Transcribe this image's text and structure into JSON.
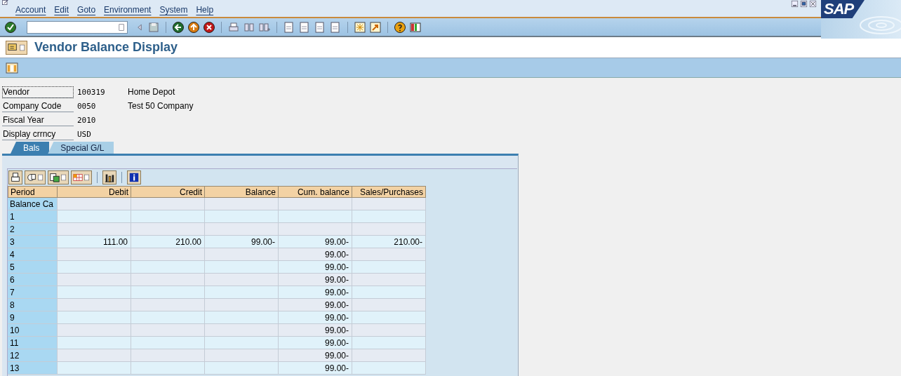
{
  "menu": [
    {
      "label": "Account"
    },
    {
      "label": "Edit"
    },
    {
      "label": "Goto"
    },
    {
      "label": "Environment"
    },
    {
      "label": "System"
    },
    {
      "label": "Help"
    }
  ],
  "logo": "SAP",
  "title": "Vendor Balance Display",
  "header_fields": [
    {
      "label": "Vendor",
      "value": "100319",
      "description": "Home Depot",
      "focused": true
    },
    {
      "label": "Company Code",
      "value": "0050",
      "description": "Test 50 Company",
      "focused": false
    },
    {
      "label": "Fiscal Year",
      "value": "2010",
      "focused": false
    },
    {
      "label": "Display crrncy",
      "value": "USD",
      "focused": false
    }
  ],
  "tabs": [
    {
      "label": "Bals",
      "selected": true
    },
    {
      "label": "Special G/L",
      "selected": false
    }
  ],
  "table": {
    "columns": [
      "Period",
      "Debit",
      "Credit",
      "Balance",
      "Cum. balance",
      "Sales/Purchases"
    ],
    "rows": [
      {
        "period": "Balance Ca"
      },
      {
        "period": "1"
      },
      {
        "period": "2"
      },
      {
        "period": "3",
        "debit": "111.00",
        "credit": "210.00",
        "balance": "99.00-",
        "cum_balance": "99.00-",
        "sales": "210.00-"
      },
      {
        "period": "4",
        "cum_balance": "99.00-"
      },
      {
        "period": "5",
        "cum_balance": "99.00-"
      },
      {
        "period": "6",
        "cum_balance": "99.00-"
      },
      {
        "period": "7",
        "cum_balance": "99.00-"
      },
      {
        "period": "8",
        "cum_balance": "99.00-"
      },
      {
        "period": "9",
        "cum_balance": "99.00-"
      },
      {
        "period": "10",
        "cum_balance": "99.00-"
      },
      {
        "period": "11",
        "cum_balance": "99.00-"
      },
      {
        "period": "12",
        "cum_balance": "99.00-"
      },
      {
        "period": "13",
        "cum_balance": "99.00-"
      }
    ]
  }
}
